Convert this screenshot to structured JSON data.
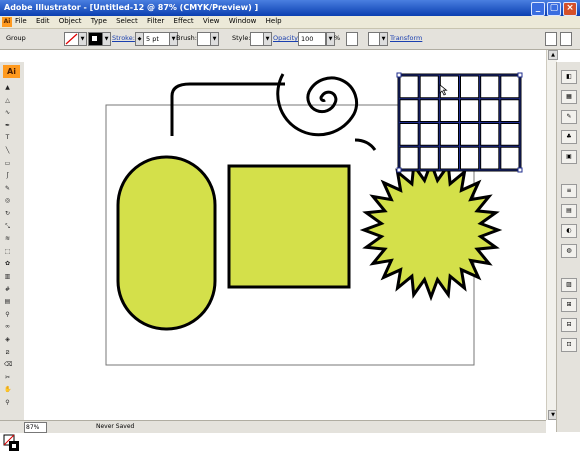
{
  "window": {
    "title": "Adobe Illustrator - [Untitled-12 @ 87% (CMYK/Preview) ]",
    "app_icon_text": "Ai"
  },
  "menu": [
    "File",
    "Edit",
    "Object",
    "Type",
    "Select",
    "Filter",
    "Effect",
    "View",
    "Window",
    "Help"
  ],
  "control_bar": {
    "selection_label": "Group",
    "stroke_label": "Stroke:",
    "stroke_value": "5 pt",
    "brush_label": "Brush:",
    "style_label": "Style:",
    "opacity_label": "Opacity:",
    "opacity_value": "100",
    "percent": "%",
    "transform_label": "Transform"
  },
  "status": {
    "zoom": "87%",
    "save_state": "Never Saved"
  },
  "colors": {
    "shape_fill": "#d4e04a",
    "selection": "#1d2b8c",
    "title_bar": "#0b3fb0",
    "menu_bar": "#ece9d8"
  },
  "tools": [
    "selection-tool",
    "direct-selection-tool",
    "lasso-tool",
    "pen-tool",
    "type-tool",
    "line-tool",
    "rectangle-tool",
    "paintbrush-tool",
    "pencil-tool",
    "blob-tool",
    "rotate-tool",
    "scale-tool",
    "warp-tool",
    "free-transform-tool",
    "symbol-tool",
    "graph-tool",
    "mesh-tool",
    "gradient-tool",
    "eyedropper-tool",
    "blend-tool",
    "live-paint-tool",
    "slice-tool",
    "eraser-tool",
    "scissors-tool",
    "hand-tool",
    "zoom-tool"
  ],
  "panels": [
    "color-panel",
    "swatches-panel",
    "brushes-panel",
    "symbols-panel",
    "graphic-styles-panel",
    "stroke-panel",
    "gradient-panel",
    "transparency-panel",
    "appearance-panel",
    "layers-panel",
    "align-panel",
    "pathfinder-panel",
    "navigator-panel"
  ]
}
